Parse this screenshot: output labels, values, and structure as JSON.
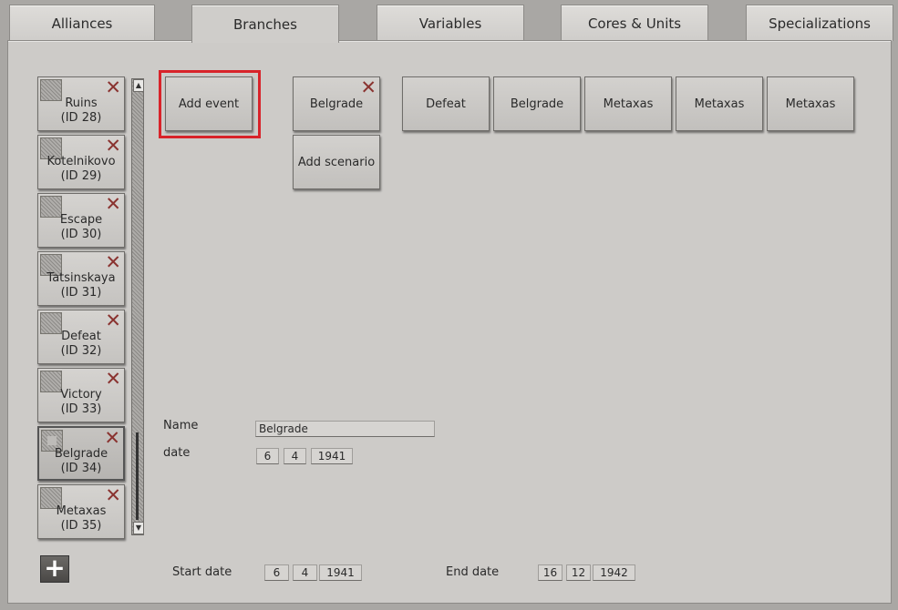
{
  "tabs": [
    {
      "label": "Alliances"
    },
    {
      "label": "Branches"
    },
    {
      "label": "Variables"
    },
    {
      "label": "Cores & Units"
    },
    {
      "label": "Specializations"
    }
  ],
  "events": [
    {
      "name": "Ruins",
      "id": "(ID 28)"
    },
    {
      "name": "Kotelnikovo",
      "id": "(ID 29)"
    },
    {
      "name": "Escape",
      "id": "(ID 30)"
    },
    {
      "name": "Tatsinskaya",
      "id": "(ID 31)"
    },
    {
      "name": "Defeat",
      "id": "(ID 32)"
    },
    {
      "name": "Victory",
      "id": "(ID 33)"
    },
    {
      "name": "Belgrade",
      "id": "(ID 34)"
    },
    {
      "name": "Metaxas",
      "id": "(ID 35)"
    }
  ],
  "selected_event_index": 6,
  "add_event_label": "Add event",
  "current_event_label": "Belgrade",
  "add_scenario_label": "Add scenario",
  "branch_buttons": [
    "Defeat",
    "Belgrade",
    "Metaxas",
    "Metaxas",
    "Metaxas"
  ],
  "form": {
    "name_label": "Name",
    "name_value": "Belgrade",
    "date_label": "date",
    "date": {
      "day": "6",
      "month": "4",
      "year": "1941"
    },
    "start_label": "Start date",
    "start": {
      "day": "6",
      "month": "4",
      "year": "1941"
    },
    "end_label": "End date",
    "end": {
      "day": "16",
      "month": "12",
      "year": "1942"
    }
  },
  "icons": {
    "delete": "close-x-icon",
    "add": "plus-icon",
    "scroll_up": "arrow-up-icon",
    "scroll_down": "arrow-down-icon"
  },
  "colors": {
    "highlight": "#d8232a",
    "delete": "#8a3330",
    "panel": "#cdcbc8"
  }
}
